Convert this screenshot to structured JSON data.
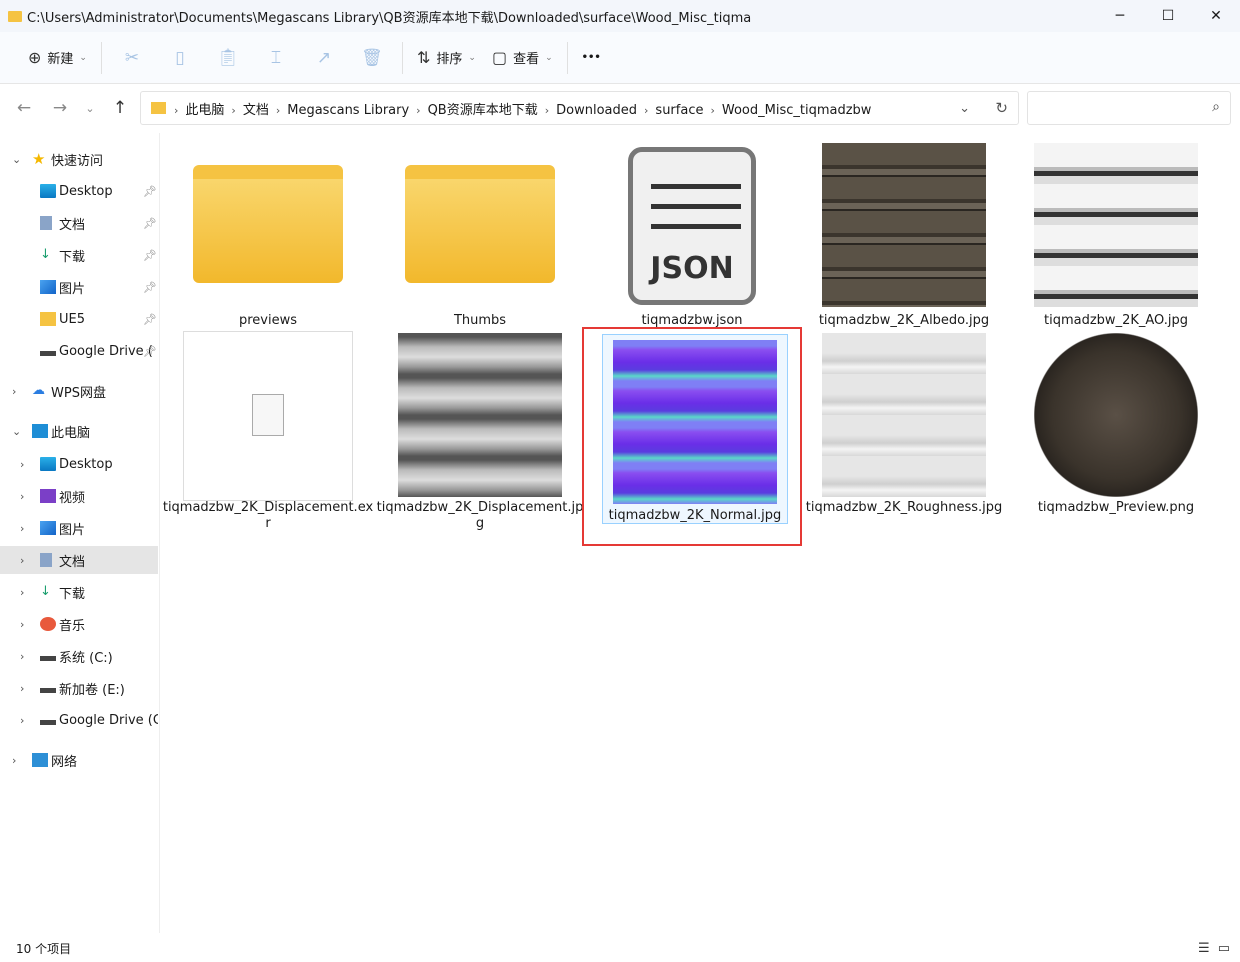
{
  "window": {
    "title": "C:\\Users\\Administrator\\Documents\\Megascans Library\\QB资源库本地下载\\Downloaded\\surface\\Wood_Misc_tiqma",
    "minimize": "─",
    "maximize": "☐",
    "close": "✕"
  },
  "toolbar": {
    "new_label": "新建",
    "sort_label": "排序",
    "view_label": "查看",
    "more": "•••",
    "icons": [
      "cut-icon",
      "copy-icon",
      "paste-icon",
      "rename-icon",
      "share-icon",
      "delete-icon"
    ]
  },
  "address": {
    "crumbs": [
      "此电脑",
      "文档",
      "Megascans Library",
      "QB资源库本地下载",
      "Downloaded",
      "surface",
      "Wood_Misc_tiqmadzbw"
    ],
    "search_placeholder": ""
  },
  "sidebar": {
    "items": [
      {
        "label": "快速访问",
        "icon": "star-icon",
        "pinned": false
      },
      {
        "label": "Desktop",
        "icon": "desktop-icon",
        "pinned": true
      },
      {
        "label": "文档",
        "icon": "documents-icon",
        "pinned": true
      },
      {
        "label": "下载",
        "icon": "download-icon",
        "pinned": true
      },
      {
        "label": "图片",
        "icon": "pictures-icon",
        "pinned": true
      },
      {
        "label": "UE5",
        "icon": "folder-icon",
        "pinned": true
      },
      {
        "label": "Google Drive (",
        "icon": "drive-icon",
        "pinned": true
      },
      {
        "label": "WPS网盘",
        "icon": "cloud-icon"
      },
      {
        "label": "此电脑",
        "icon": "pc-icon"
      },
      {
        "label": "Desktop",
        "icon": "desktop-icon"
      },
      {
        "label": "视频",
        "icon": "video-icon"
      },
      {
        "label": "图片",
        "icon": "pictures-icon"
      },
      {
        "label": "文档",
        "icon": "documents-icon",
        "selected": true
      },
      {
        "label": "下载",
        "icon": "download-icon"
      },
      {
        "label": "音乐",
        "icon": "music-icon"
      },
      {
        "label": "系统 (C:)",
        "icon": "drive-icon"
      },
      {
        "label": "新加卷 (E:)",
        "icon": "drive-icon"
      },
      {
        "label": "Google Drive (G:)",
        "icon": "drive-icon"
      },
      {
        "label": "网络",
        "icon": "network-icon"
      }
    ]
  },
  "files": [
    {
      "name": "previews",
      "type": "folder"
    },
    {
      "name": "Thumbs",
      "type": "folder"
    },
    {
      "name": "tiqmadzbw.json",
      "type": "json",
      "badge": "JSON"
    },
    {
      "name": "tiqmadzbw_2K_Albedo.jpg",
      "type": "albedo"
    },
    {
      "name": "tiqmadzbw_2K_AO.jpg",
      "type": "ao"
    },
    {
      "name": "tiqmadzbw_2K_Displacement.exr",
      "type": "blank"
    },
    {
      "name": "tiqmadzbw_2K_Displacement.jpg",
      "type": "disp"
    },
    {
      "name": "tiqmadzbw_2K_Normal.jpg",
      "type": "normal",
      "selected": true
    },
    {
      "name": "tiqmadzbw_2K_Roughness.jpg",
      "type": "rough"
    },
    {
      "name": "tiqmadzbw_Preview.png",
      "type": "sphere"
    }
  ],
  "status": {
    "count": "10 个项目"
  },
  "colors": {
    "highlight_box": "#e53935",
    "folder": "#f5c342",
    "selection": "#cce8ff"
  }
}
